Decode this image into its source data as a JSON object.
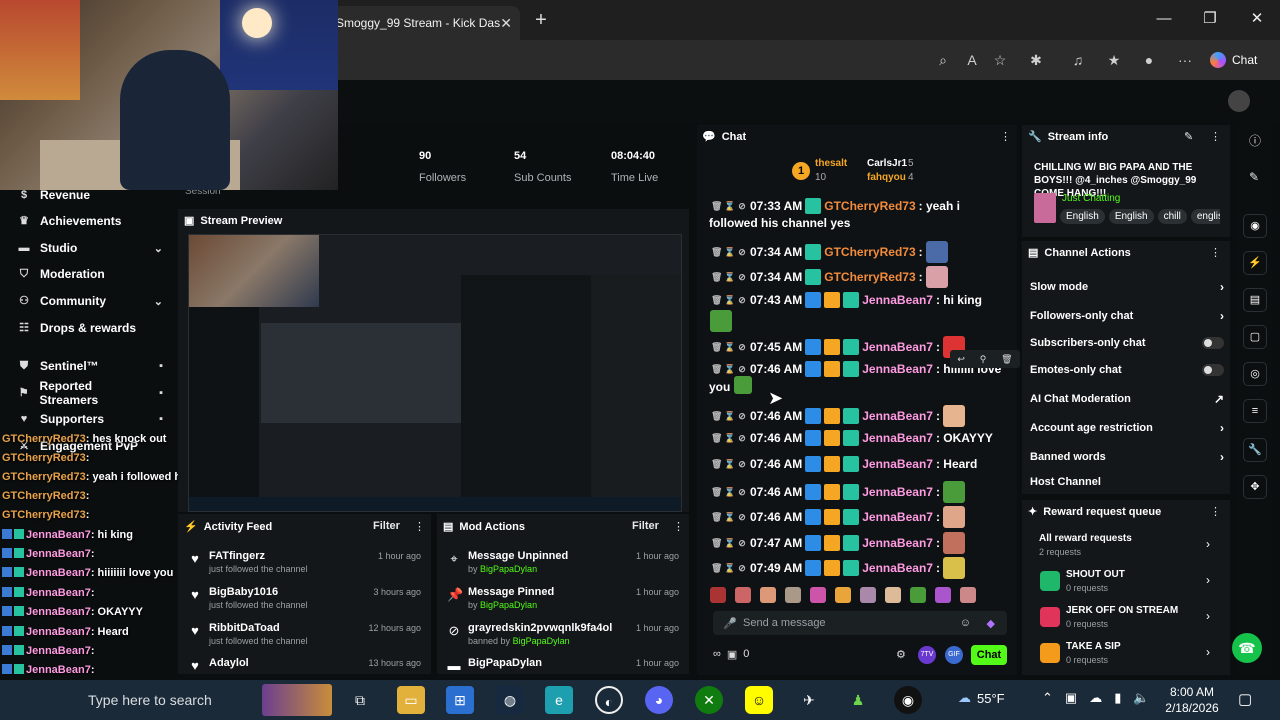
{
  "browser": {
    "tab_title": "Smoggy_99 Stream - Kick Das",
    "copilot_label": "Chat",
    "minimize": "—",
    "maximize": "❐",
    "close": "✕"
  },
  "stats": {
    "followers_value": "90",
    "followers_label": "Followers",
    "subs_value": "54",
    "subs_label": "Sub Counts",
    "time_value": "08:04:40",
    "time_label": "Time Live",
    "session_label": "Session"
  },
  "sidebar": {
    "items": [
      {
        "label": "Revenue"
      },
      {
        "label": "Achievements"
      },
      {
        "label": "Studio"
      },
      {
        "label": "Moderation"
      },
      {
        "label": "Community"
      },
      {
        "label": "Drops & rewards"
      },
      {
        "label": "Sentinel™"
      },
      {
        "label": "Reported Streamers"
      },
      {
        "label": "Supporters"
      },
      {
        "label": "Engagement PvP"
      }
    ]
  },
  "overlay_chat": [
    {
      "user": "GTCherryRed73",
      "text": ": hes knock out"
    },
    {
      "user": "GTCherryRed73",
      "text": ":"
    },
    {
      "user": "GTCherryRed73",
      "text": ": yeah i followed his channel yes"
    },
    {
      "user": "GTCherryRed73",
      "text": ":"
    },
    {
      "user": "GTCherryRed73",
      "text": ":"
    },
    {
      "user": "JennaBean7",
      "text": ": hi king"
    },
    {
      "user": "JennaBean7",
      "text": ":"
    },
    {
      "user": "JennaBean7",
      "text": ": hiiiiiii love you"
    },
    {
      "user": "JennaBean7",
      "text": ":"
    },
    {
      "user": "JennaBean7",
      "text": ": OKAYYY"
    },
    {
      "user": "JennaBean7",
      "text": ": Heard"
    },
    {
      "user": "JennaBean7",
      "text": ":"
    },
    {
      "user": "JennaBean7",
      "text": ":"
    },
    {
      "user": "JennaBean7",
      "text": ":"
    },
    {
      "user": "JennaBean7",
      "text": ":"
    }
  ],
  "preview": {
    "title": "Stream Preview"
  },
  "activity": {
    "title": "Activity Feed",
    "filter": "Filter",
    "rows": [
      {
        "name": "FATfingerz",
        "sub": "just followed the channel",
        "time": "1 hour ago"
      },
      {
        "name": "BigBaby1016",
        "sub": "just followed the channel",
        "time": "3 hours ago"
      },
      {
        "name": "RibbitDaToad",
        "sub": "just followed the channel",
        "time": "12 hours ago"
      },
      {
        "name": "Adaylol",
        "sub": "",
        "time": "13 hours ago"
      }
    ]
  },
  "mod_actions": {
    "title": "Mod Actions",
    "filter": "Filter",
    "rows": [
      {
        "name": "Message Unpinned",
        "by": "by",
        "actor": "BigPapaDylan",
        "time": "1 hour ago"
      },
      {
        "name": "Message Pinned",
        "by": "by",
        "actor": "BigPapaDylan",
        "time": "1 hour ago"
      },
      {
        "name": "grayredskin2pvwqnlk9fa4ol",
        "by": "banned by",
        "actor": "BigPapaDylan",
        "time": "1 hour ago"
      },
      {
        "name": "BigPapaDylan",
        "by": "",
        "actor": "",
        "time": "1 hour ago"
      }
    ]
  },
  "chat": {
    "title": "Chat",
    "top_gifters": [
      {
        "name": "thesalt",
        "count": "10"
      },
      {
        "name": "CarlsJr1",
        "count": "5"
      },
      {
        "name": "fahqyou",
        "count": "4"
      }
    ],
    "first_line": {
      "time": "07:33 AM",
      "user": "GTCherryRed73",
      "text": ": yeah i"
    },
    "first_line_cont": "followed his channel yes",
    "messages": [
      {
        "time": "07:34 AM",
        "user": "GTCherryRed73",
        "text": ":",
        "kind": "gt"
      },
      {
        "time": "07:34 AM",
        "user": "GTCherryRed73",
        "text": ":",
        "kind": "gt"
      },
      {
        "time": "07:43 AM",
        "user": "JennaBean7",
        "text": ": hi king",
        "kind": "jb"
      },
      {
        "time": "07:45 AM",
        "user": "JennaBean7",
        "text": ":",
        "kind": "jb"
      },
      {
        "time": "07:46 AM",
        "user": "JennaBean7",
        "text": ": hiiiiiii love",
        "kind": "jb"
      },
      {
        "time": "07:46 AM",
        "user": "JennaBean7",
        "text": ":",
        "kind": "jb"
      },
      {
        "time": "07:46 AM",
        "user": "JennaBean7",
        "text": ": OKAYYY",
        "kind": "jb"
      },
      {
        "time": "07:46 AM",
        "user": "JennaBean7",
        "text": ": Heard",
        "kind": "jb"
      },
      {
        "time": "07:46 AM",
        "user": "JennaBean7",
        "text": ":",
        "kind": "jb"
      },
      {
        "time": "07:46 AM",
        "user": "JennaBean7",
        "text": ":",
        "kind": "jb"
      },
      {
        "time": "07:47 AM",
        "user": "JennaBean7",
        "text": ":",
        "kind": "jb"
      },
      {
        "time": "07:49 AM",
        "user": "JennaBean7",
        "text": ":",
        "kind": "jb"
      }
    ],
    "love_you_cont": "you",
    "input_placeholder": "Send a message",
    "send_label": "Chat",
    "viewer_count": "0",
    "gift_count": "0"
  },
  "stream_info": {
    "title": "Stream info",
    "stream_title": "CHILLING W/ BIG PAPA AND THE BOYS!!! @4_inches @Smoggy_99 COME HANG!!!",
    "category": "Just Chatting",
    "tags": [
      "English",
      "English",
      "chill",
      "englis"
    ]
  },
  "channel_actions": {
    "title": "Channel Actions",
    "rows": [
      {
        "label": "Slow mode",
        "control": "chevron"
      },
      {
        "label": "Followers-only chat",
        "control": "chevron"
      },
      {
        "label": "Subscribers-only chat",
        "control": "toggle"
      },
      {
        "label": "Emotes-only chat",
        "control": "toggle"
      },
      {
        "label": "AI Chat Moderation",
        "control": "external"
      },
      {
        "label": "Account age restriction",
        "control": "chevron"
      },
      {
        "label": "Banned words",
        "control": "chevron"
      },
      {
        "label": "Host Channel",
        "control": "none"
      }
    ]
  },
  "reward_queue": {
    "title": "Reward request queue",
    "all_label": "All reward requests",
    "all_count": "2 requests",
    "rewards": [
      {
        "title": "SHOUT OUT",
        "count": "0 requests",
        "color": "#1fb86a"
      },
      {
        "title": "JERK OFF ON STREAM",
        "count": "0 requests",
        "color": "#e0345a"
      },
      {
        "title": "TAKE A SIP",
        "count": "0 requests",
        "color": "#f59b1c"
      }
    ]
  },
  "taskbar": {
    "search_placeholder": "Type here to search",
    "weather": "55°F",
    "time": "8:00 AM",
    "date": "2/18/2026"
  },
  "colors": {
    "kick_green": "#53fc18",
    "accent_gold": "#f5a623",
    "jenna_pink": "#ff9be2",
    "gt_orange": "#f28b3c"
  }
}
